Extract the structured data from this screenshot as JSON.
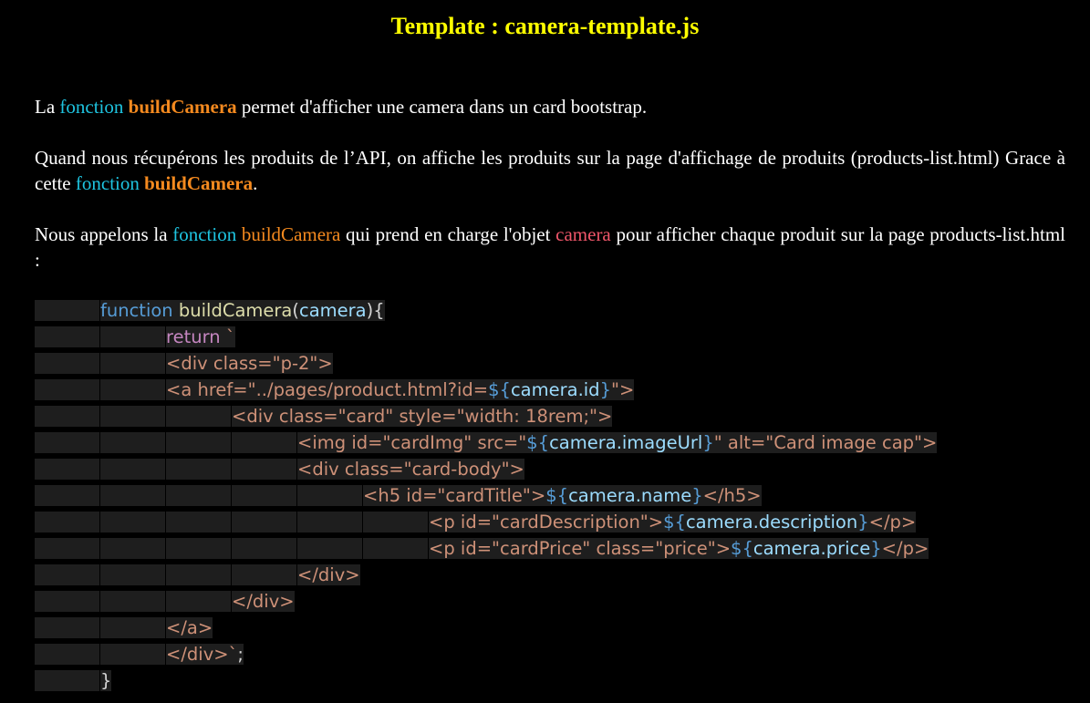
{
  "title": "Template : camera-template.js",
  "paragraph1": {
    "t1": "La ",
    "keyword": "fonction",
    "t2": " ",
    "fn": "buildCamera",
    "t3": " permet d'afficher une camera dans un card bootstrap."
  },
  "paragraph2": {
    "t1": "Quand nous récupérons les produits de l’API, on affiche les produits sur la page d'affichage de produits (products-list.html) Grace à cette ",
    "keyword": "fonction",
    "t2": " ",
    "fn": "buildCamera",
    "t3": "."
  },
  "paragraph3": {
    "t1": "Nous appelons la ",
    "keyword": "fonction",
    "t2": " ",
    "fn": "buildCamera",
    "t3": " qui prend en charge l'objet ",
    "var": "camera",
    "t4": " pour afficher chaque produit sur la page products-list.html :"
  },
  "colors": {
    "title": "#ffff00",
    "keyword": "#1ec4e0",
    "function_name": "#f58a1f",
    "object_name": "#f0566a",
    "code_background": "#1e1e1e"
  },
  "code": {
    "l1": {
      "func": "function",
      "name": "buildCamera",
      "open": "(",
      "param": "camera",
      "close": "){"
    },
    "l2": {
      "ret": "return",
      "tick": " `"
    },
    "l3": {
      "text": "<div class=\"p-2\">"
    },
    "l4": {
      "a": "<a href=\"../pages/product.html?id=",
      "t1": "${",
      "v": "camera.id",
      "t2": "}",
      "b": "\">"
    },
    "l5": {
      "text": "<div class=\"card\" style=\"width: 18rem;\">"
    },
    "l6": {
      "a": "<img id=\"cardImg\" src=\"",
      "t1": "${",
      "v": "camera.imageUrl",
      "t2": "}",
      "b": "\" alt=\"Card image cap\">"
    },
    "l7": {
      "text": "<div class=\"card-body\">"
    },
    "l8": {
      "a": "<h5 id=\"cardTitle\">",
      "t1": "${",
      "v": "camera.name",
      "t2": "}",
      "b": "</h5>"
    },
    "l9": {
      "a": "<p id=\"cardDescription\">",
      "t1": "${",
      "v": "camera.description",
      "t2": "}",
      "b": "</p>"
    },
    "l10": {
      "a": "<p id=\"cardPrice\" class=\"price\">",
      "t1": "${",
      "v": "camera.price",
      "t2": "}",
      "b": "</p>"
    },
    "l11": {
      "text": "</div>"
    },
    "l12": {
      "text": "</div>"
    },
    "l13": {
      "text": "</a>"
    },
    "l14": {
      "text": "</div>`",
      "end": ";"
    },
    "l15": {
      "text": "}"
    }
  }
}
